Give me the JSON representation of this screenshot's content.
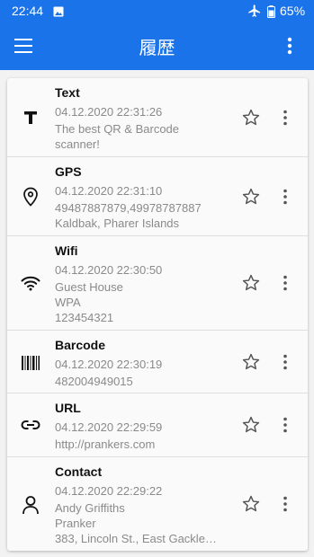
{
  "status_bar": {
    "time": "22:44",
    "battery": "65%"
  },
  "app_bar": {
    "title": "履歴"
  },
  "history": [
    {
      "type": "Text",
      "date": "04.12.2020 22:31:26",
      "lines": [
        "The best QR & Barcode",
        "scanner!"
      ]
    },
    {
      "type": "GPS",
      "date": "04.12.2020 22:31:10",
      "lines": [
        "49487887879,49978787887",
        "Kaldbak, Pharer Islands"
      ]
    },
    {
      "type": "Wifi",
      "date": "04.12.2020 22:30:50",
      "lines": [
        "Guest House",
        "WPA",
        "123454321"
      ]
    },
    {
      "type": "Barcode",
      "date": "04.12.2020 22:30:19",
      "lines": [
        "482004949015"
      ]
    },
    {
      "type": "URL",
      "date": "04.12.2020 22:29:59",
      "lines": [
        "http://prankers.com"
      ]
    },
    {
      "type": "Contact",
      "date": "04.12.2020 22:29:22",
      "lines": [
        "Andy Griffiths",
        "Pranker",
        "383, Lincoln St., East Gackle…"
      ]
    }
  ],
  "colors": {
    "primary": "#1a73e8",
    "card": "#fafafa",
    "muted": "#8a8a8a"
  }
}
